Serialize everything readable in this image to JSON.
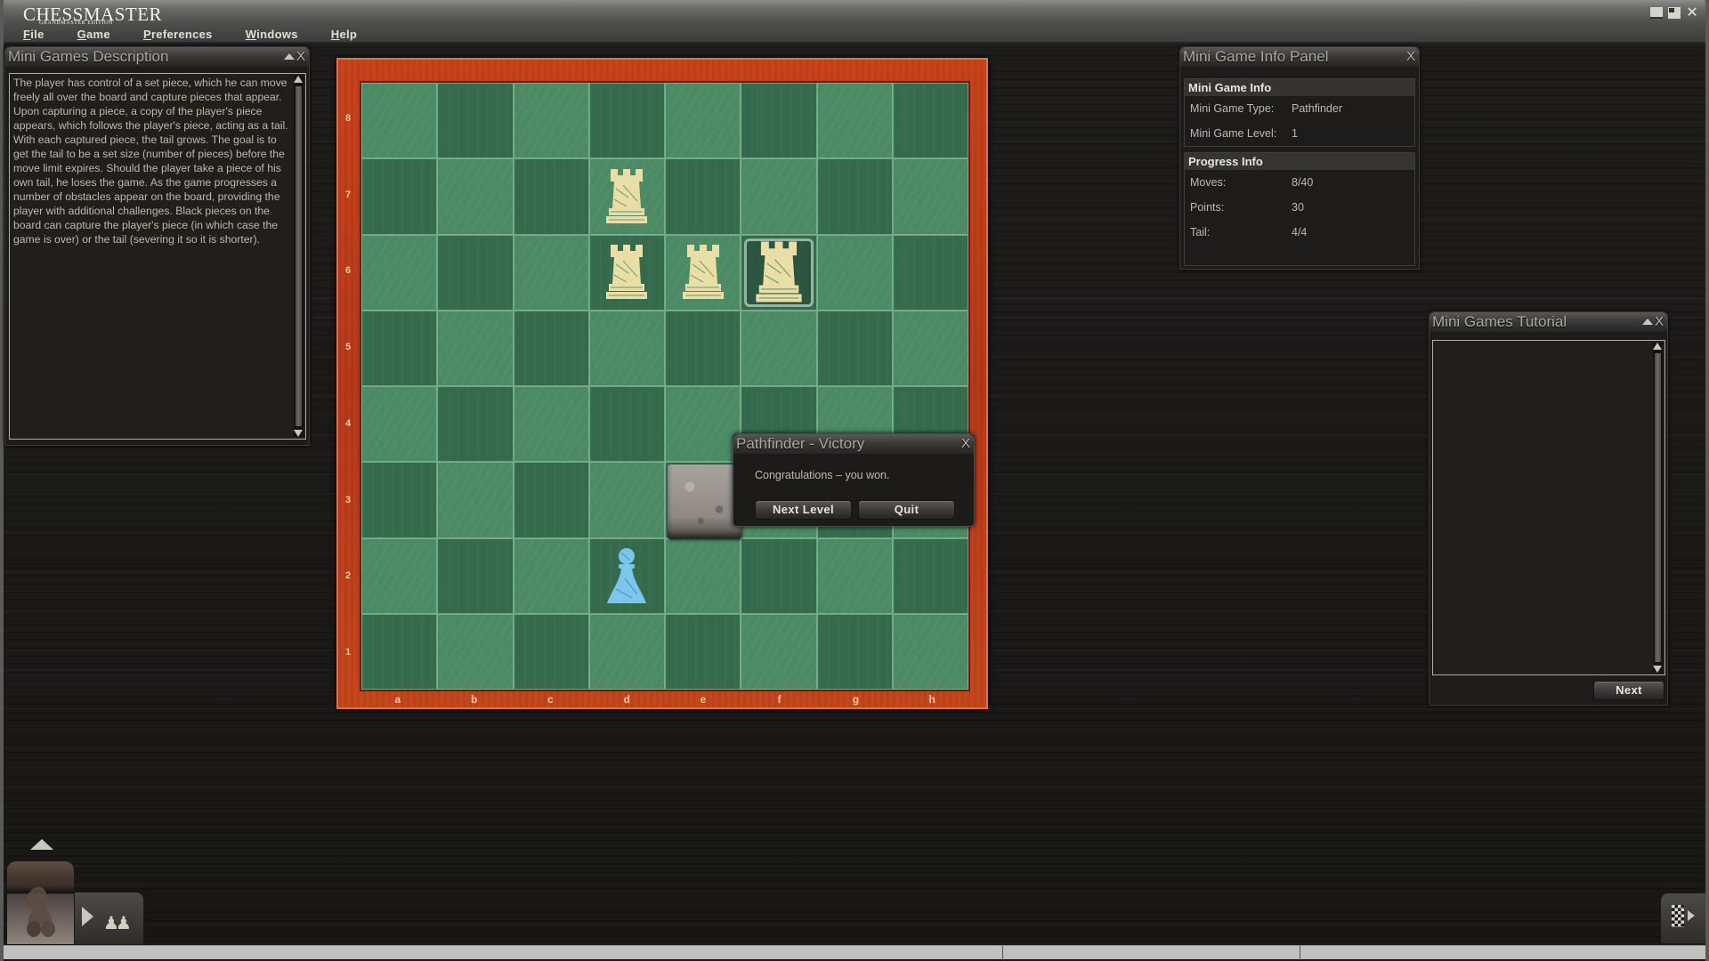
{
  "app": {
    "logo_main": "CHESSMASTER",
    "logo_sub": "GRANDMASTER EDITION",
    "window_controls": [
      "minimize-icon",
      "restore-icon",
      "close-icon"
    ]
  },
  "menu": [
    {
      "label": "File",
      "accel": "F",
      "rest": "ile"
    },
    {
      "label": "Game",
      "accel": "G",
      "rest": "ame"
    },
    {
      "label": "Preferences",
      "accel": "P",
      "rest": "references"
    },
    {
      "label": "Windows",
      "accel": "W",
      "rest": "indows"
    },
    {
      "label": "Help",
      "accel": "H",
      "rest": "elp"
    }
  ],
  "description_panel": {
    "title": "Mini Games Description",
    "text": "The player has control of a set piece, which he can move freely all over the board and capture pieces that appear. Upon capturing a piece, a copy of the player's piece appears, which follows the player's piece, acting as a tail. With each captured piece, the tail grows. The goal is to get the tail to be a set size (number of pieces) before the move limit expires. Should the player take a piece of his own tail, he loses the game. As the game progresses a number of obstacles appear on the board, providing the player with additional challenges. Black pieces on the board can capture the player's piece (in which case the game is over) or the tail (severing it so it is shorter)."
  },
  "info_panel": {
    "title": "Mini Game Info Panel",
    "sections": [
      {
        "header": "Mini Game Info",
        "rows": [
          {
            "label": "Mini Game Type:",
            "value": "Pathfinder"
          },
          {
            "label": "Mini Game Level:",
            "value": "1"
          }
        ]
      },
      {
        "header": "Progress Info",
        "rows": [
          {
            "label": "Moves:",
            "value": "8/40"
          },
          {
            "label": "Points:",
            "value": "30"
          },
          {
            "label": "Tail:",
            "value": "4/4"
          }
        ]
      }
    ]
  },
  "tutorial_panel": {
    "title": "Mini Games Tutorial",
    "text": "",
    "next_label": "Next"
  },
  "board": {
    "ranks": [
      "8",
      "7",
      "6",
      "5",
      "4",
      "3",
      "2",
      "1"
    ],
    "files": [
      "a",
      "b",
      "c",
      "d",
      "e",
      "f",
      "g",
      "h"
    ],
    "pieces": [
      {
        "square": "d7",
        "type": "rook",
        "color": "white",
        "role": "tail"
      },
      {
        "square": "d6",
        "type": "rook",
        "color": "white",
        "role": "tail"
      },
      {
        "square": "e6",
        "type": "rook",
        "color": "white",
        "role": "tail"
      },
      {
        "square": "f6",
        "type": "rook",
        "color": "white",
        "role": "player",
        "selected": true
      },
      {
        "square": "d2",
        "type": "pawn",
        "color": "blue",
        "role": "target"
      },
      {
        "square": "e3",
        "type": "obstacle",
        "color": "stone",
        "role": "obstacle"
      }
    ],
    "colors": {
      "frame": "#c0401b",
      "light_square": "#4b8a64",
      "dark_square": "#356b4d",
      "white_piece": "#e9dfa6",
      "blue_piece": "#7cc6ec"
    }
  },
  "dialog": {
    "title": "Pathfinder - Victory",
    "message": "Congratulations – you won.",
    "buttons": {
      "next_level": "Next Level",
      "quit": "Quit"
    }
  },
  "bottom": {
    "left_icons": [
      "up-arrow-icon",
      "knight-avatar-icon",
      "play-arrow-icon",
      "players-icon"
    ],
    "right_icons": [
      "chessboard-icon",
      "right-arrow-icon"
    ]
  }
}
